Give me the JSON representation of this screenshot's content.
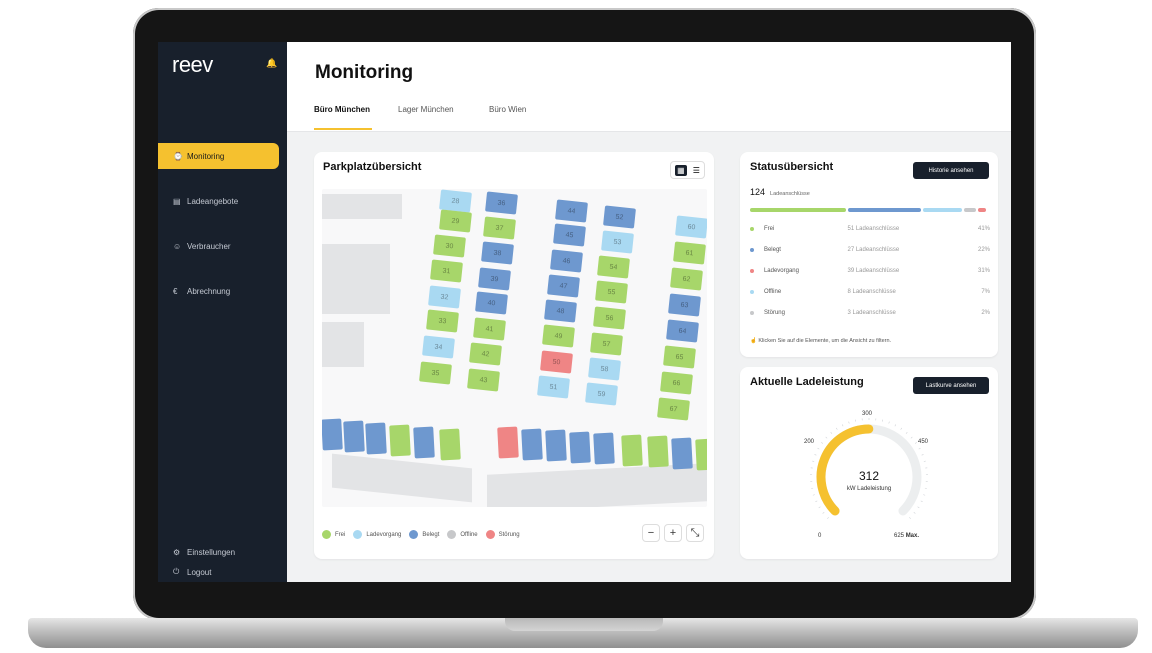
{
  "app": {
    "logo": "reev"
  },
  "sidebar": {
    "items": [
      {
        "label": "Monitoring",
        "icon": "monitor-icon",
        "active": true
      },
      {
        "label": "Ladeangebote",
        "icon": "document-icon",
        "active": false
      },
      {
        "label": "Verbraucher",
        "icon": "users-icon",
        "active": false
      },
      {
        "label": "Abrechnung",
        "icon": "euro-icon",
        "active": false
      }
    ],
    "bottom": [
      {
        "label": "Einstellungen",
        "icon": "gear-icon"
      },
      {
        "label": "Logout",
        "icon": "logout-icon"
      }
    ]
  },
  "header": {
    "title": "Monitoring",
    "tabs": [
      "Büro München",
      "Lager München",
      "Büro Wien"
    ],
    "active_tab": 0
  },
  "parking": {
    "title": "Parkplatzübersicht",
    "legend": [
      {
        "label": "Frei",
        "color": "#a7d66a"
      },
      {
        "label": "Ladevorgang",
        "color": "#a9d9f2"
      },
      {
        "label": "Belegt",
        "color": "#6e98cf"
      },
      {
        "label": "Offline",
        "color": "#c7c8ca"
      },
      {
        "label": "Störung",
        "color": "#ef8585"
      }
    ],
    "zoom": {
      "minus": "−",
      "plus": "+",
      "fit": "⤡"
    }
  },
  "status": {
    "title": "Statusübersicht",
    "button": "Historie ansehen",
    "total": "124",
    "total_label": "Ladeanschlüsse",
    "rows": [
      {
        "name": "Frei",
        "count": "51 Ladeanschlüsse",
        "pct": "41%",
        "color": "#a7d66a"
      },
      {
        "name": "Belegt",
        "count": "27 Ladeanschlüsse",
        "pct": "22%",
        "color": "#6e98cf"
      },
      {
        "name": "Ladevorgang",
        "count": "39 Ladeanschlüsse",
        "pct": "31%",
        "color": "#ef8585"
      },
      {
        "name": "Offline",
        "count": "8 Ladeanschlüsse",
        "pct": "7%",
        "color": "#a9d9f2"
      },
      {
        "name": "Störung",
        "count": "3 Ladeanschlüsse",
        "pct": "2%",
        "color": "#c7c8ca"
      }
    ],
    "bar": [
      {
        "color": "#a7d66a",
        "value": 0.41
      },
      {
        "color": "#6e98cf",
        "value": 0.31
      },
      {
        "color": "#a9d9f2",
        "value": 0.17
      },
      {
        "color": "#c7c8ca",
        "value": 0.06
      },
      {
        "color": "#ef8585",
        "value": 0.04
      }
    ],
    "hint": "Klicken Sie auf die Elemente, um die Ansicht zu filtern."
  },
  "power": {
    "title": "Aktuelle Ladeleistung",
    "button": "Lastkurve ansehen",
    "value": "312",
    "unit": "kW Ladeleistung",
    "ticks": [
      "0",
      "200",
      "300",
      "450",
      "625"
    ],
    "max_label": "Max.",
    "max_value": 625,
    "current": 312,
    "accent": "#f5c12f"
  }
}
